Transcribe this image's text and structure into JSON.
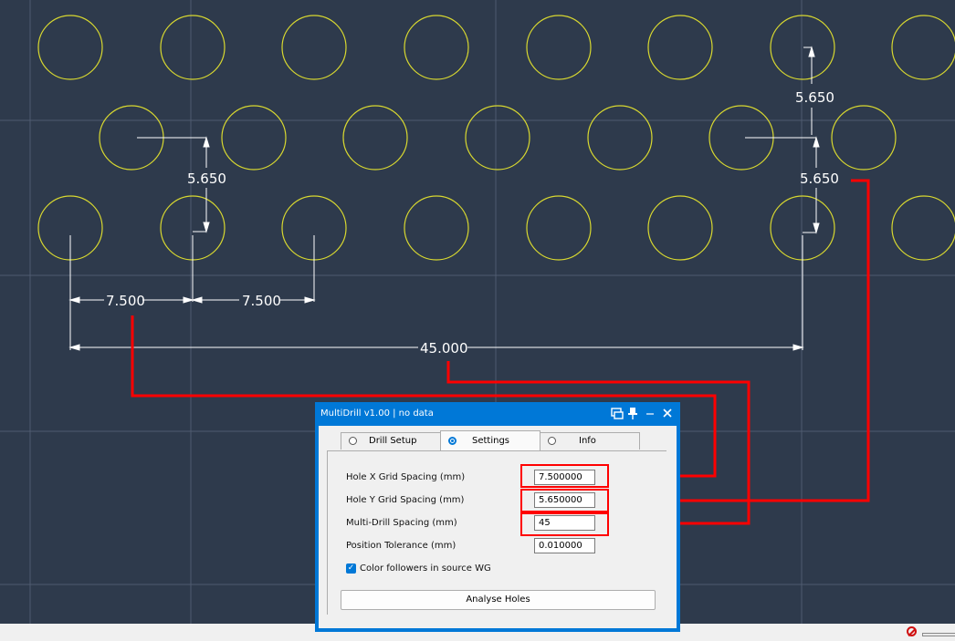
{
  "colors": {
    "background": "#2e3a4c",
    "grid": "#55617a",
    "hole": "#d8d830",
    "dimension": "#ffffff",
    "annotation": "#ff0000",
    "accent": "#0078d7"
  },
  "cad": {
    "dimensions": {
      "y_left": "5.650",
      "y_right_top": "5.650",
      "y_right_bottom": "5.650",
      "x_first": "7.500",
      "x_second": "7.500",
      "multi_drill": "45.000"
    }
  },
  "dialog": {
    "title": "MultiDrill v1.00 | no data",
    "icons": [
      "screen-icon",
      "pin-icon",
      "minimize-icon",
      "close-icon"
    ],
    "tabs": [
      {
        "label": "Drill Setup",
        "selected": false
      },
      {
        "label": "Settings",
        "selected": true
      },
      {
        "label": "Info",
        "selected": false
      }
    ],
    "fields": [
      {
        "label": "Hole X Grid Spacing (mm)",
        "value": "7.500000"
      },
      {
        "label": "Hole Y Grid Spacing (mm)",
        "value": "5.650000"
      },
      {
        "label": "Multi-Drill Spacing (mm)",
        "value": "45"
      },
      {
        "label": "Position Tolerance (mm)",
        "value": "0.010000"
      }
    ],
    "checkbox": {
      "label": "Color followers in source WG",
      "checked": true
    },
    "button": {
      "label": "Analyse Holes"
    }
  }
}
